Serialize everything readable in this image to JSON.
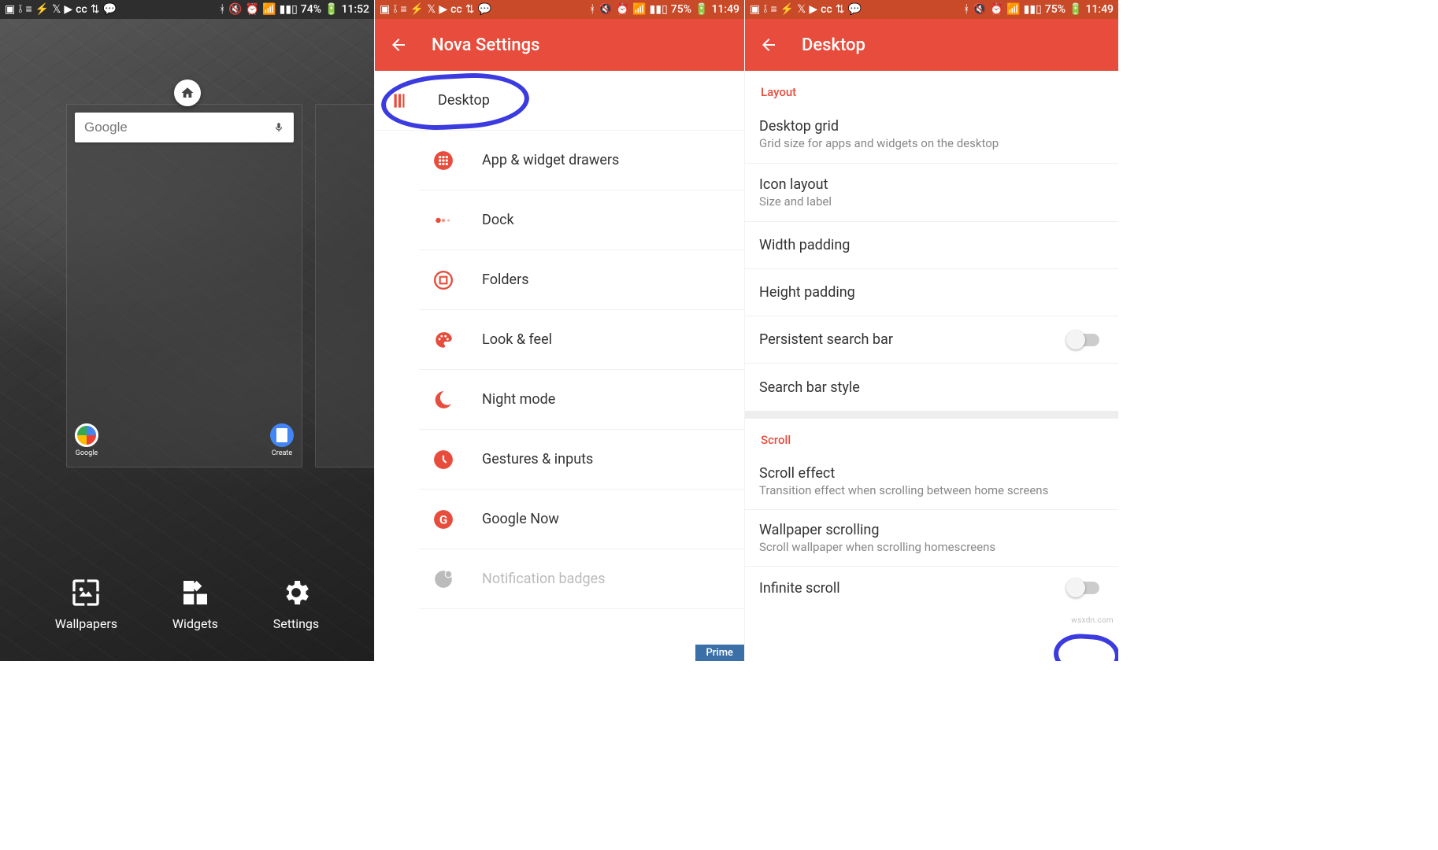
{
  "colors": {
    "accent": "#e74c3c",
    "statusRed": "#c94a29",
    "annotation": "#3b3be0"
  },
  "status": {
    "battery_a": "74%",
    "time_a": "11:52",
    "battery_b": "75%",
    "time_b": "11:49",
    "battery_c": "75%",
    "time_c": "11:49",
    "left_icons": [
      "image-icon",
      "check-icon",
      "list-icon",
      "flash-icon",
      "twitter-icon",
      "youtube-icon",
      "cc-icon",
      "updown-icon",
      "chat-icon"
    ],
    "right_icons": [
      "bluetooth-icon",
      "mute-icon",
      "alarm-icon",
      "wifi-icon",
      "signal-icon"
    ]
  },
  "pane0": {
    "search_label": "Google",
    "apps": {
      "google": "Google",
      "create": "Create"
    },
    "actions": {
      "wallpapers": "Wallpapers",
      "widgets": "Widgets",
      "settings": "Settings"
    }
  },
  "pane1": {
    "title": "Nova Settings",
    "items": [
      {
        "icon": "desktop",
        "label": "Desktop"
      },
      {
        "icon": "drawer",
        "label": "App & widget drawers"
      },
      {
        "icon": "dock",
        "label": "Dock"
      },
      {
        "icon": "folders",
        "label": "Folders"
      },
      {
        "icon": "look",
        "label": "Look & feel"
      },
      {
        "icon": "night",
        "label": "Night mode"
      },
      {
        "icon": "gestures",
        "label": "Gestures & inputs"
      },
      {
        "icon": "gnow",
        "label": "Google Now"
      },
      {
        "icon": "badges",
        "label": "Notification badges",
        "disabled": true
      }
    ],
    "prime": "Prime"
  },
  "pane2": {
    "title": "Desktop",
    "sections": [
      {
        "header": "Layout",
        "items": [
          {
            "title": "Desktop grid",
            "sub": "Grid size for apps and widgets on the desktop"
          },
          {
            "title": "Icon layout",
            "sub": "Size and label"
          },
          {
            "title": "Width padding"
          },
          {
            "title": "Height padding"
          },
          {
            "title": "Persistent search bar",
            "toggle": true
          },
          {
            "title": "Search bar style"
          }
        ]
      },
      {
        "header": "Scroll",
        "items": [
          {
            "title": "Scroll effect",
            "sub": "Transition effect when scrolling between home screens"
          },
          {
            "title": "Wallpaper scrolling",
            "sub": "Scroll wallpaper when scrolling homescreens"
          },
          {
            "title": "Infinite scroll",
            "toggle": true
          }
        ]
      }
    ],
    "watermark": "wsxdn.com"
  }
}
